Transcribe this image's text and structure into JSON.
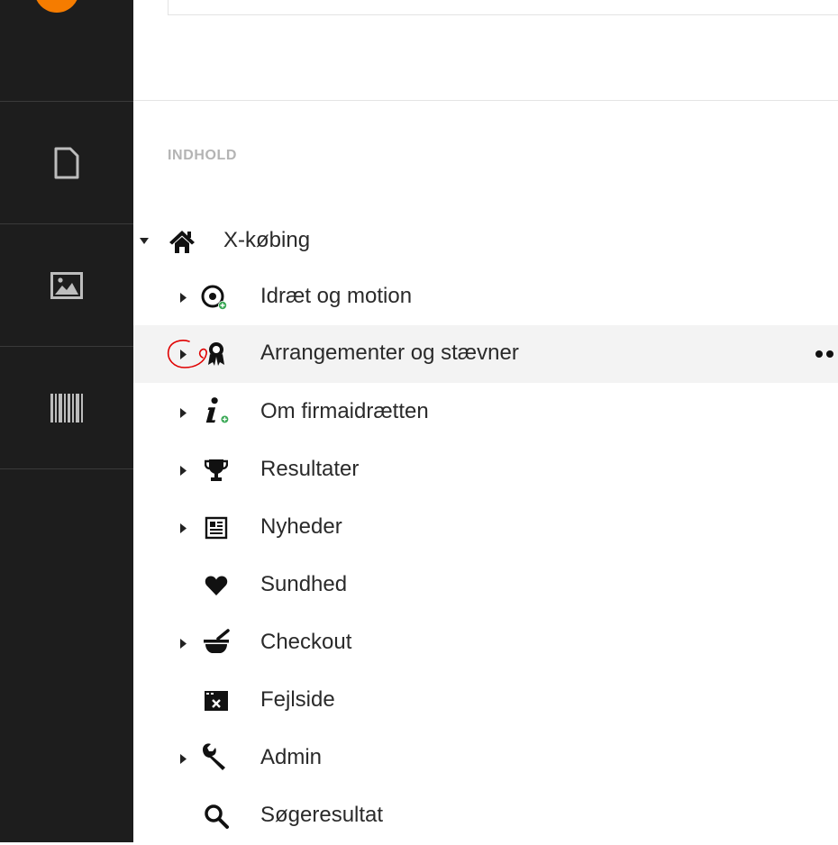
{
  "sidebar": {
    "items": [
      {
        "name": "content",
        "icon": "document-icon"
      },
      {
        "name": "media",
        "icon": "image-icon"
      },
      {
        "name": "barcode",
        "icon": "barcode-icon"
      }
    ]
  },
  "section": {
    "title": "INDHOLD"
  },
  "tree": {
    "root": {
      "label": "X-købing",
      "icon": "home-icon",
      "expanded": true
    },
    "children": [
      {
        "label": "Idræt og motion",
        "icon": "target-plus-icon",
        "has_children": true
      },
      {
        "label": "Arrangementer og stævner",
        "icon": "award-icon",
        "has_children": true,
        "highlighted": true
      },
      {
        "label": "Om firmaidrætten",
        "icon": "info-plus-icon",
        "has_children": true
      },
      {
        "label": "Resultater",
        "icon": "trophy-icon",
        "has_children": true
      },
      {
        "label": "Nyheder",
        "icon": "newspaper-icon",
        "has_children": true
      },
      {
        "label": "Sundhed",
        "icon": "heart-icon",
        "has_children": false
      },
      {
        "label": "Checkout",
        "icon": "mortar-pestle-icon",
        "has_children": true
      },
      {
        "label": "Fejlside",
        "icon": "window-error-icon",
        "has_children": false
      },
      {
        "label": "Admin",
        "icon": "wrench-icon",
        "has_children": true
      },
      {
        "label": "Søgeresultat",
        "icon": "search-icon",
        "has_children": false
      }
    ]
  },
  "colors": {
    "rail": "#1d1d1d",
    "accent": "#f57c00",
    "highlight": "#f3f3f3",
    "annotation": "#e00000"
  }
}
